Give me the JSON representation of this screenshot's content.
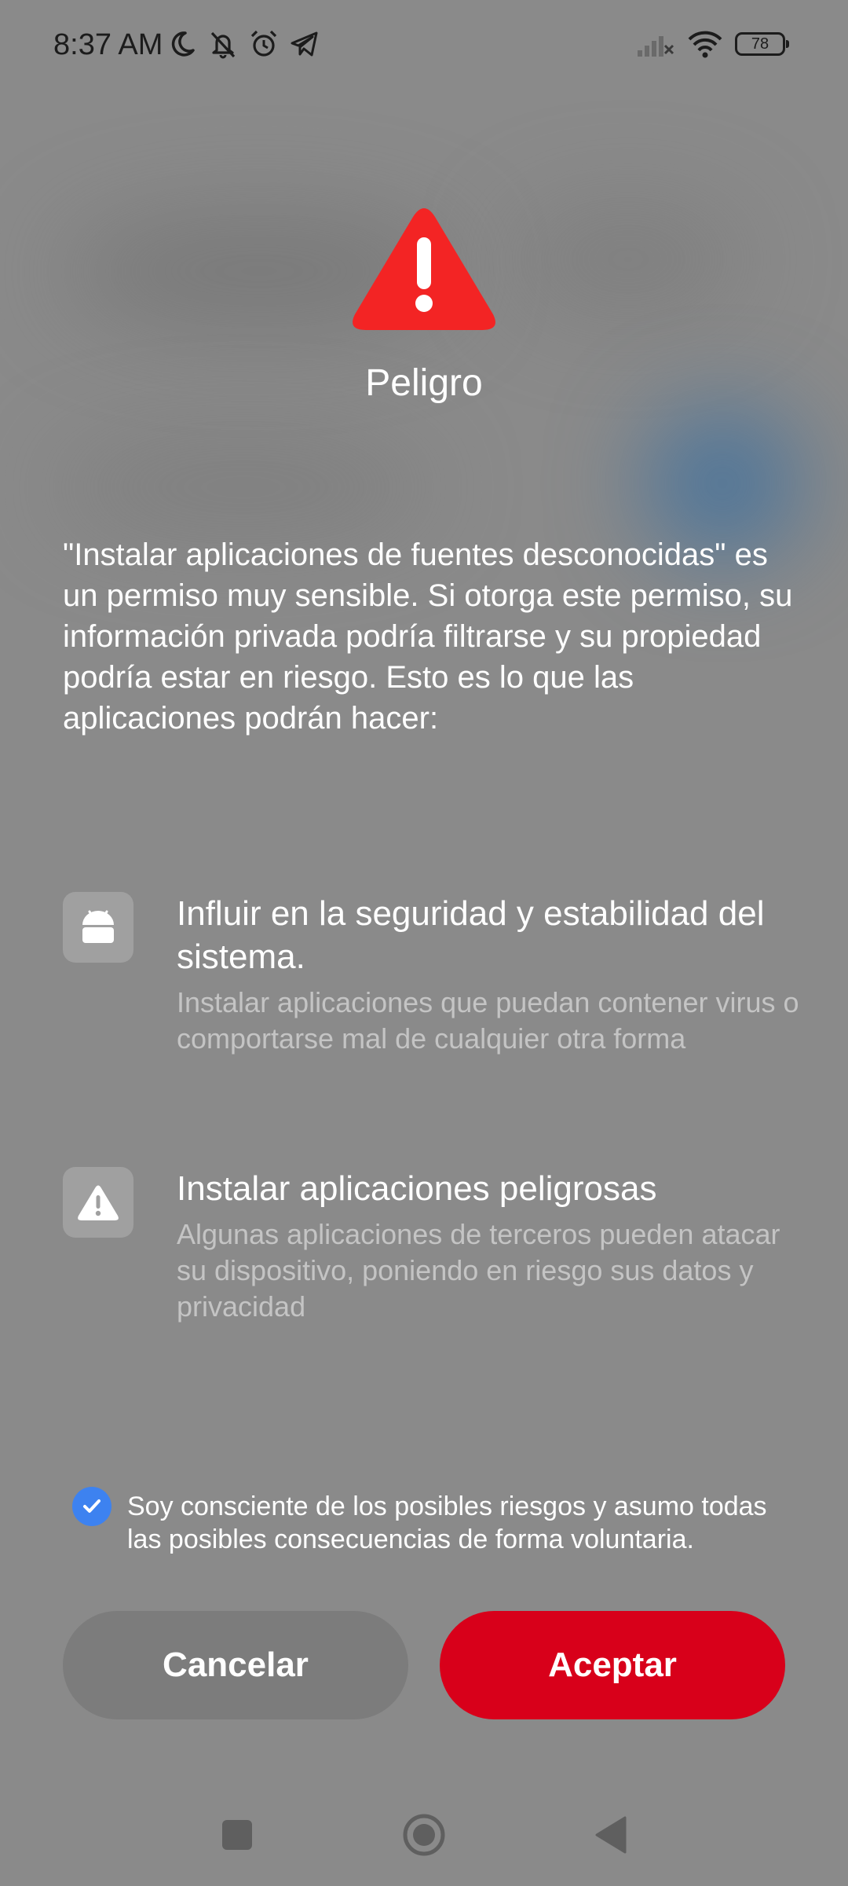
{
  "status_bar": {
    "time": "8:37 AM",
    "left_icons": [
      "moon-icon",
      "bell-off-icon",
      "alarm-icon",
      "telegram-icon"
    ],
    "right_icons": [
      "signal-no-service-icon",
      "wifi-icon",
      "battery-icon"
    ],
    "battery_level": "78"
  },
  "dialog": {
    "icon": "warning-triangle-icon",
    "icon_color": "#f32424",
    "title": "Peligro",
    "description": "\"Instalar aplicaciones de fuentes desconocidas\" es un permiso muy sensible. Si otorga este permiso, su información privada podría filtrarse y su propiedad podría estar en riesgo. Esto es lo que las aplicaciones podrán hacer:"
  },
  "permissions": [
    {
      "icon": "android-icon",
      "title": "Influir en la seguridad y estabilidad del sistema.",
      "description": "Instalar aplicaciones que puedan contener virus o comportarse mal de cualquier otra forma"
    },
    {
      "icon": "warning-icon",
      "title": "Instalar aplicaciones peligrosas",
      "description": "Algunas aplicaciones de terceros pueden atacar su dispositivo, poniendo en riesgo sus datos y privacidad"
    }
  ],
  "consent": {
    "checked": true,
    "text": "Soy consciente de los posibles riesgos y asumo todas las posibles consecuencias de forma voluntaria.",
    "checkbox_color": "#3d82f0"
  },
  "buttons": {
    "cancel_label": "Cancelar",
    "accept_label": "Aceptar",
    "accept_color": "#d8001a"
  },
  "nav_bar": {
    "items": [
      "recents-icon",
      "home-icon",
      "back-icon"
    ]
  }
}
